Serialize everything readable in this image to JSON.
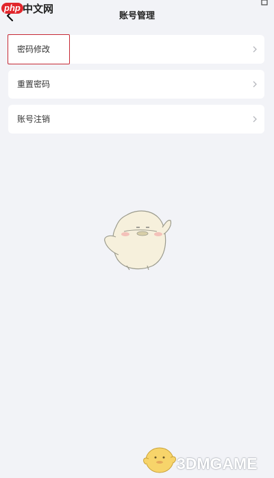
{
  "watermark_top": {
    "logo": "php",
    "text": "中文网"
  },
  "header": {
    "title": "账号管理"
  },
  "menu": [
    {
      "label": "密码修改"
    },
    {
      "label": "重置密码"
    },
    {
      "label": "账号注销"
    }
  ],
  "watermark_bottom": {
    "text": "3DMGAME"
  },
  "colors": {
    "background": "#f2f3f7",
    "card": "#ffffff",
    "highlight": "#c62833",
    "php_logo": "#e1262c"
  },
  "icons": {
    "back": "chevron-left-icon",
    "row_arrow": "chevron-right-icon",
    "mascot": "bird-mascot-illustration"
  }
}
